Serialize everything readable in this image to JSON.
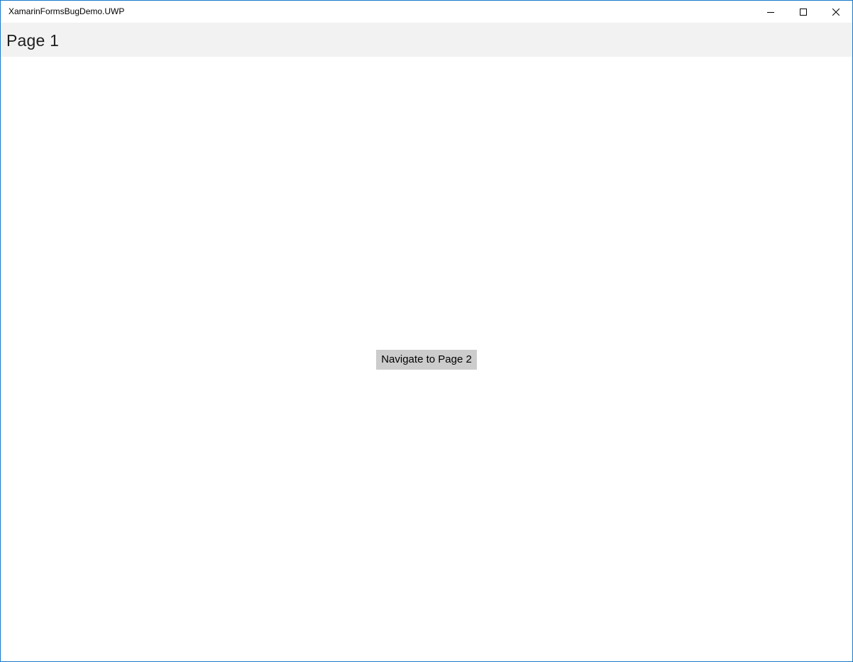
{
  "window": {
    "title": "XamarinFormsBugDemo.UWP",
    "controls": {
      "minimize_icon": "minimize-icon",
      "maximize_icon": "maximize-icon",
      "close_icon": "close-icon"
    }
  },
  "navbar": {
    "title": "Page 1"
  },
  "main": {
    "navigate_button_label": "Navigate to Page 2"
  },
  "colors": {
    "window_border": "#1979ca",
    "navbar_background": "#f2f2f2",
    "button_background": "#cccccc"
  }
}
